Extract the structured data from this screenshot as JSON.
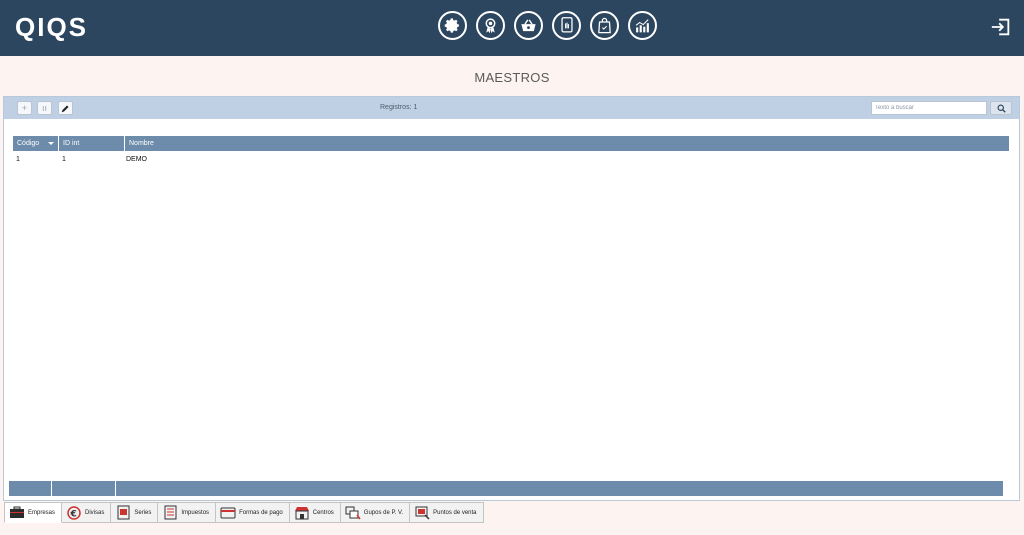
{
  "brand": {
    "logo_text": "QIQS"
  },
  "header": {
    "nav_icons": [
      "gear-icon",
      "award-badge-icon",
      "basket-icon",
      "touch-terminal-icon",
      "shopping-bag-icon",
      "analytics-icon"
    ],
    "logout_icon": "sign-out-icon"
  },
  "page": {
    "title": "MAESTROS"
  },
  "toolbar": {
    "add_label": "+",
    "delete_label": "ıı",
    "registros": "Registros: 1",
    "search_placeholder": "Texto a buscar"
  },
  "grid": {
    "columns": [
      "Código",
      "ID int",
      "Nombre"
    ],
    "rows": [
      {
        "codigo": "1",
        "id_int": "1",
        "nombre": "DEMO"
      }
    ]
  },
  "tabs": [
    {
      "label": "Empresas",
      "icon": "briefcase-icon",
      "selected": true
    },
    {
      "label": "Divisas",
      "icon": "euro-icon",
      "selected": false
    },
    {
      "label": "Series",
      "icon": "series-book-icon",
      "selected": false
    },
    {
      "label": "Impuestos",
      "icon": "tax-document-icon",
      "selected": false
    },
    {
      "label": "Formas de pago",
      "icon": "credit-card-icon",
      "selected": false
    },
    {
      "label": "Centros",
      "icon": "store-icon",
      "selected": false
    },
    {
      "label": "Gupos de P. V.",
      "icon": "pos-group-icon",
      "selected": false
    },
    {
      "label": "Puntos de venta",
      "icon": "point-of-sale-icon",
      "selected": false
    }
  ],
  "colors": {
    "header": "#2d4660",
    "toolbar": "#c0d0e4",
    "grid_header": "#6d8cab",
    "background": "#fdf3f1"
  }
}
